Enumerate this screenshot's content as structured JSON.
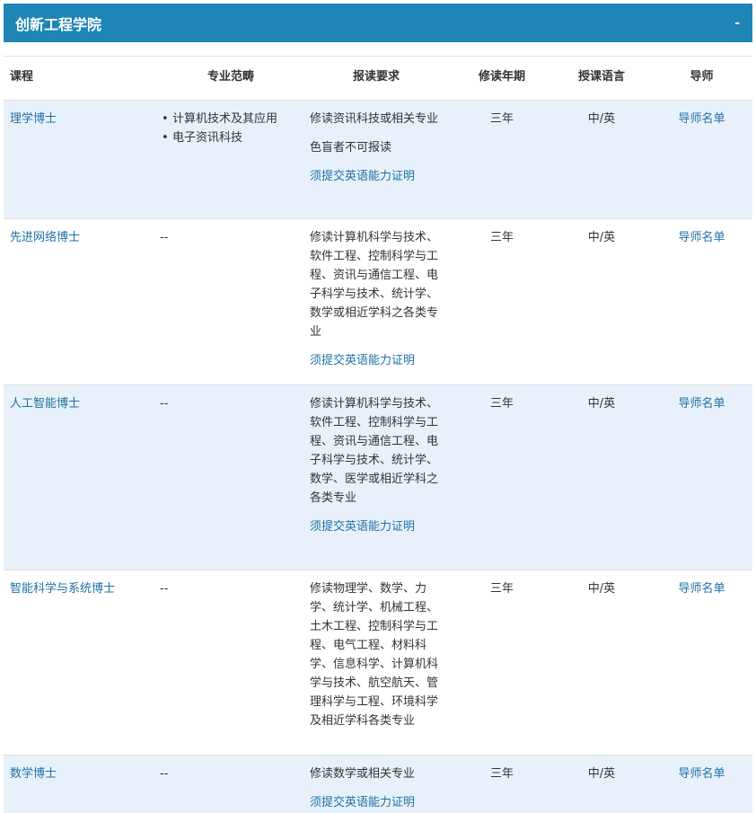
{
  "panel": {
    "title": "创新工程学院",
    "toggle": "-"
  },
  "columns": {
    "course": "课程",
    "major": "专业范畴",
    "requirement": "报读要求",
    "years": "修读年期",
    "language": "授课语言",
    "tutor": "导师"
  },
  "rows": [
    {
      "course": "理学博士",
      "majors": [
        "计算机技术及其应用",
        "电子资讯科技"
      ],
      "requirements": [
        "修读资讯科技或相关专业",
        "色盲者不可报读"
      ],
      "english_proof": "须提交英语能力证明",
      "years": "三年",
      "language": "中/英",
      "tutor": "导师名单"
    },
    {
      "course": "先进网络博士",
      "major_none": "--",
      "requirements": [
        "修读计算机科学与技术、软件工程、控制科学与工程、资讯与通信工程、电子科学与技术、统计学、数学或相近学科之各类专业"
      ],
      "english_proof": "须提交英语能力证明",
      "years": "三年",
      "language": "中/英",
      "tutor": "导师名单"
    },
    {
      "course": "人工智能博士",
      "major_none": "--",
      "requirements": [
        "修读计算机科学与技术、软件工程、控制科学与工程、资讯与通信工程、电子科学与技术、统计学、数学、医学或相近学科之各类专业"
      ],
      "english_proof": "须提交英语能力证明",
      "years": "三年",
      "language": "中/英",
      "tutor": "导师名单"
    },
    {
      "course": "智能科学与系统博士",
      "major_none": "--",
      "requirements": [
        "修读物理学、数学、力学、统计学、机械工程、土木工程、控制科学与工程、电气工程、材料科学、信息科学、计算机科学与技术、航空航天、管理科学与工程、环境科学及相近学科各类专业"
      ],
      "years": "三年",
      "language": "中/英",
      "tutor": "导师名单"
    },
    {
      "course": "数学博士",
      "major_none": "--",
      "requirements": [
        "修读数学或相关专业"
      ],
      "english_proof": "须提交英语能力证明",
      "years": "三年",
      "language": "中/英",
      "tutor": "导师名单"
    }
  ]
}
